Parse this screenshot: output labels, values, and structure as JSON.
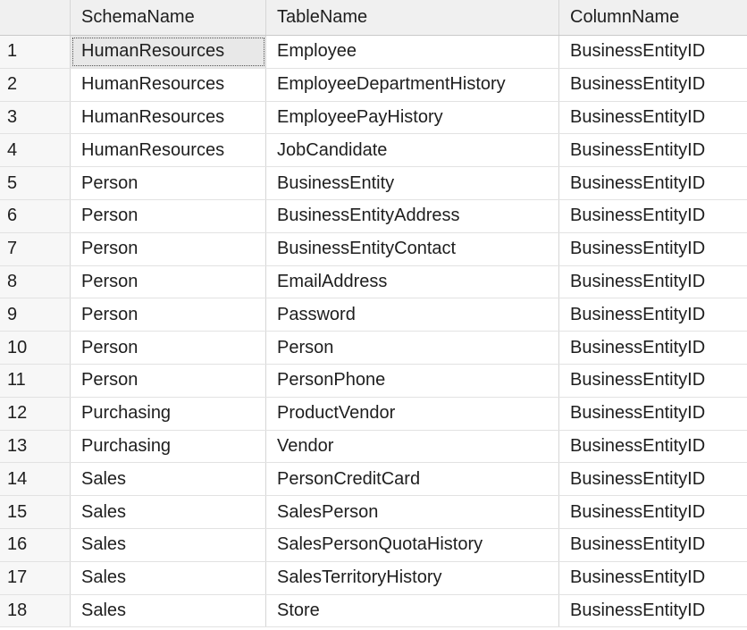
{
  "grid": {
    "columns": [
      "",
      "SchemaName",
      "TableName",
      "ColumnName"
    ],
    "rows": [
      {
        "n": "1",
        "schema": "HumanResources",
        "table": "Employee",
        "column": "BusinessEntityID"
      },
      {
        "n": "2",
        "schema": "HumanResources",
        "table": "EmployeeDepartmentHistory",
        "column": "BusinessEntityID"
      },
      {
        "n": "3",
        "schema": "HumanResources",
        "table": "EmployeePayHistory",
        "column": "BusinessEntityID"
      },
      {
        "n": "4",
        "schema": "HumanResources",
        "table": "JobCandidate",
        "column": "BusinessEntityID"
      },
      {
        "n": "5",
        "schema": "Person",
        "table": "BusinessEntity",
        "column": "BusinessEntityID"
      },
      {
        "n": "6",
        "schema": "Person",
        "table": "BusinessEntityAddress",
        "column": "BusinessEntityID"
      },
      {
        "n": "7",
        "schema": "Person",
        "table": "BusinessEntityContact",
        "column": "BusinessEntityID"
      },
      {
        "n": "8",
        "schema": "Person",
        "table": "EmailAddress",
        "column": "BusinessEntityID"
      },
      {
        "n": "9",
        "schema": "Person",
        "table": "Password",
        "column": "BusinessEntityID"
      },
      {
        "n": "10",
        "schema": "Person",
        "table": "Person",
        "column": "BusinessEntityID"
      },
      {
        "n": "11",
        "schema": "Person",
        "table": "PersonPhone",
        "column": "BusinessEntityID"
      },
      {
        "n": "12",
        "schema": "Purchasing",
        "table": "ProductVendor",
        "column": "BusinessEntityID"
      },
      {
        "n": "13",
        "schema": "Purchasing",
        "table": "Vendor",
        "column": "BusinessEntityID"
      },
      {
        "n": "14",
        "schema": "Sales",
        "table": "PersonCreditCard",
        "column": "BusinessEntityID"
      },
      {
        "n": "15",
        "schema": "Sales",
        "table": "SalesPerson",
        "column": "BusinessEntityID"
      },
      {
        "n": "16",
        "schema": "Sales",
        "table": "SalesPersonQuotaHistory",
        "column": "BusinessEntityID"
      },
      {
        "n": "17",
        "schema": "Sales",
        "table": "SalesTerritoryHistory",
        "column": "BusinessEntityID"
      },
      {
        "n": "18",
        "schema": "Sales",
        "table": "Store",
        "column": "BusinessEntityID"
      }
    ]
  }
}
